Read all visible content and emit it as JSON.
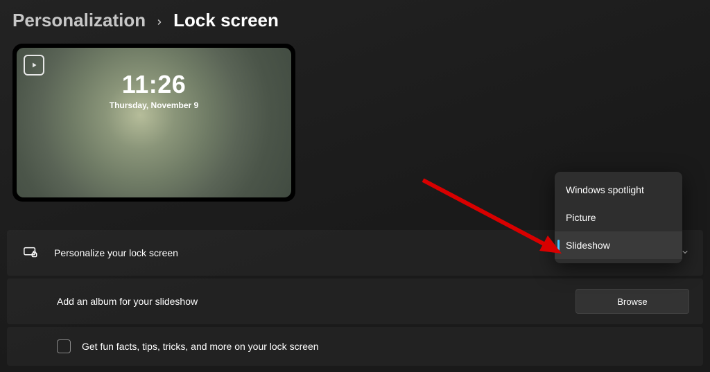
{
  "breadcrumb": {
    "parent": "Personalization",
    "current": "Lock screen"
  },
  "preview": {
    "time": "11:26",
    "date": "Thursday, November 9"
  },
  "rows": {
    "personalize": {
      "label": "Personalize your lock screen"
    },
    "addAlbum": {
      "label": "Add an album for your slideshow",
      "browse": "Browse"
    },
    "funFacts": {
      "label": "Get fun facts, tips, tricks, and more on your lock screen",
      "checked": false
    }
  },
  "dropdown": {
    "options": [
      {
        "label": "Windows spotlight"
      },
      {
        "label": "Picture"
      },
      {
        "label": "Slideshow"
      }
    ],
    "selected": "Slideshow"
  }
}
